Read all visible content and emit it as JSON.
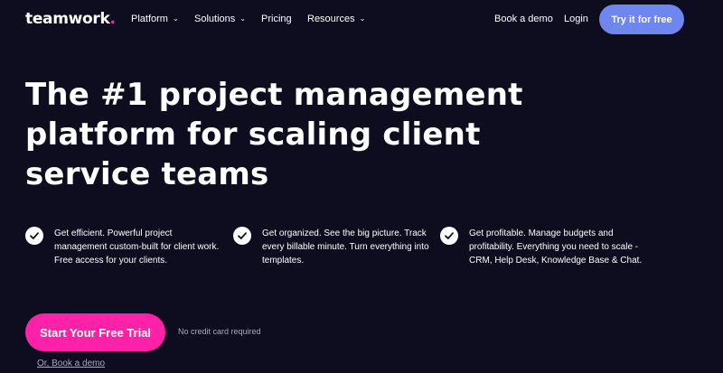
{
  "nav": {
    "logo_text": "teamwork",
    "logo_dot": ".",
    "items": [
      {
        "label": "Platform"
      },
      {
        "label": "Solutions"
      },
      {
        "label": "Pricing"
      },
      {
        "label": "Resources"
      }
    ],
    "book_demo": "Book a demo",
    "login": "Login",
    "try_free": "Try it for free"
  },
  "hero": {
    "title": "The #1 project management platform for scaling client service teams"
  },
  "features": [
    {
      "text": "Get efficient. Powerful project management custom-built for client work. Free access for your clients."
    },
    {
      "text": "Get organized. See the big picture. Track every billable minute. Turn everything into templates."
    },
    {
      "text": "Get profitable. Manage budgets and profitability. Everything you need to scale - CRM, Help Desk, Knowledge Base & Chat."
    }
  ],
  "cta": {
    "button": "Start Your Free Trial",
    "note": "No credit card required",
    "book_link": "Or, Book a demo"
  },
  "colors": {
    "background": "#0d0d1f",
    "brand_pink": "#ff22a8",
    "accent_blue": "#6f86ef",
    "muted_text": "#a7a9be"
  },
  "icons": {
    "feature_check": "check-circle-icon",
    "nav_dropdown": "chevron-down-icon"
  }
}
